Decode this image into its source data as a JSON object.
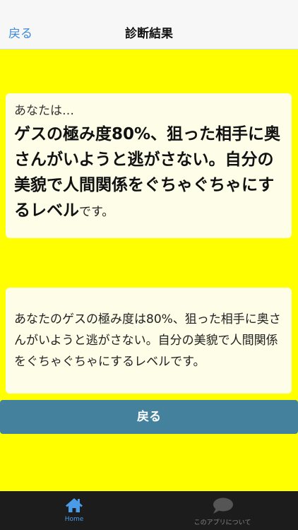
{
  "nav": {
    "back_label": "戻る",
    "title": "診断結果"
  },
  "result_card": {
    "intro": "あなたは…",
    "main_result": "ゲスの極み度80%、狙った相手に奥さんがいようと逃がさない。自分の美貌で人間関係をぐちゃぐちゃにするレベル",
    "suffix": "です。"
  },
  "detail_card": {
    "text": "あなたのゲスの極み度は80%、狙った相手に奥さんがいようと逃がさない。自分の美貌で人間関係をぐちゃぐちゃにするレベルです。"
  },
  "back_button": {
    "label": "戻る"
  },
  "tabbar": {
    "items": [
      {
        "label": "Home",
        "icon": "home-icon",
        "active": true
      },
      {
        "label": "このアプリについて",
        "icon": "speech-bubble-icon",
        "active": false
      }
    ]
  },
  "colors": {
    "background": "#ffff00",
    "card": "#fdfde8",
    "button": "#43819c",
    "nav_link": "#3b8ad8",
    "tab_active": "#4a9ce8",
    "tabbar": "#1c1c1c"
  }
}
